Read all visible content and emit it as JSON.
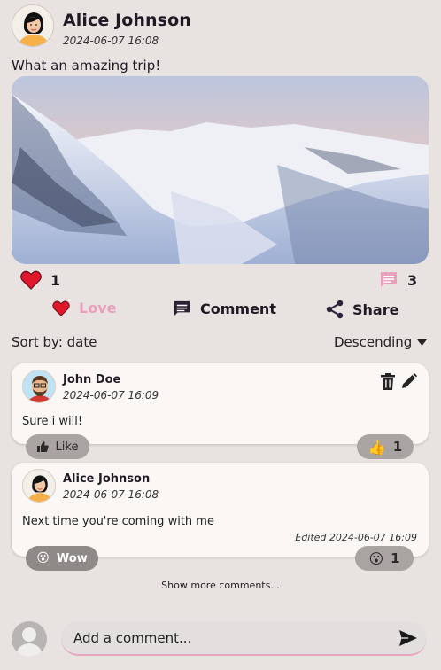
{
  "post": {
    "author": "Alice Johnson",
    "time": "2024-06-07 16:08",
    "text": "What an amazing trip!",
    "love_count": "1",
    "comment_count": "3"
  },
  "actions": {
    "love": "Love",
    "comment": "Comment",
    "share": "Share"
  },
  "sort": {
    "label": "Sort by: date",
    "order": "Descending"
  },
  "comments": [
    {
      "author": "John Doe",
      "time": "2024-06-07 16:09",
      "text": "Sure i will!",
      "reaction_label": "Like",
      "reaction_count": "1"
    },
    {
      "author": "Alice Johnson",
      "time": "2024-06-07 16:08",
      "text": "Next time you're coming with me",
      "edited": "Edited 2024-06-07 16:09",
      "reaction_label": "Wow",
      "reaction_count": "1"
    }
  ],
  "show_more": "Show more comments...",
  "composer": {
    "placeholder": "Add a comment..."
  },
  "colors": {
    "love": "#e8a0bd",
    "heart": "#e0162b",
    "background": "#e8e3e1",
    "card": "#fbf7f5"
  },
  "icons": [
    "heart-icon",
    "comment-icon",
    "share-icon",
    "trash-icon",
    "pencil-icon",
    "thumbs-up-icon",
    "wow-icon",
    "send-icon",
    "user-icon",
    "chevron-down-icon"
  ]
}
